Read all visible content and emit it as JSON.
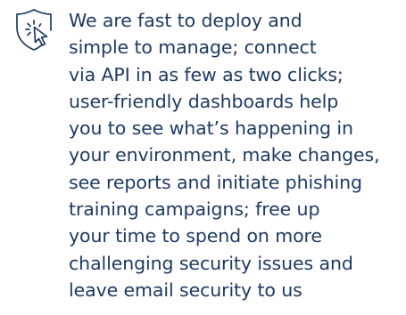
{
  "feature": {
    "icon": "shield-cursor-click-icon",
    "accent_color": "#1e3a62",
    "lines": [
      "We are fast to deploy and",
      "simple to manage; connect",
      "via API in as few as two clicks;",
      "user-friendly dashboards help",
      "you to see what’s happening in",
      "your environment, make changes,",
      "see reports and initiate phishing",
      "training campaigns; free up",
      "your time to spend on more",
      "challenging security issues and",
      "leave email security to us"
    ]
  }
}
